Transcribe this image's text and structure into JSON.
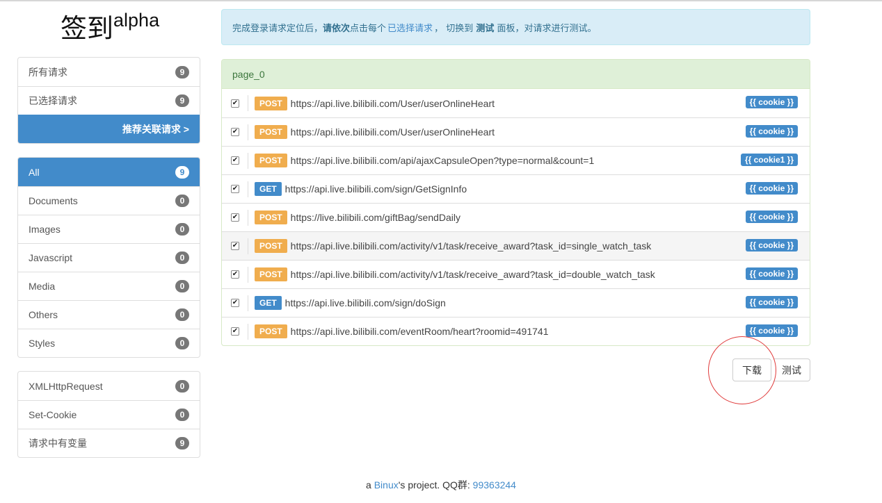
{
  "brand": {
    "title": "签到",
    "sup": "alpha"
  },
  "sidebar": {
    "group1": [
      {
        "label": "所有请求",
        "count": "9"
      },
      {
        "label": "已选择请求",
        "count": "9"
      }
    ],
    "recommend_label": "推荐关联请求 >",
    "types": [
      {
        "label": "All",
        "count": "9"
      },
      {
        "label": "Documents",
        "count": "0"
      },
      {
        "label": "Images",
        "count": "0"
      },
      {
        "label": "Javascript",
        "count": "0"
      },
      {
        "label": "Media",
        "count": "0"
      },
      {
        "label": "Others",
        "count": "0"
      },
      {
        "label": "Styles",
        "count": "0"
      }
    ],
    "filters": [
      {
        "label": "XMLHttpRequest",
        "count": "0"
      },
      {
        "label": "Set-Cookie",
        "count": "0"
      },
      {
        "label": "请求中有变量",
        "count": "9"
      }
    ]
  },
  "alert": {
    "part1": "完成登录请求定位后，",
    "bold1": "请依次",
    "part2": "点击每个",
    "link": "已选择请求",
    "part3": "， 切换到",
    "bold2": "测试",
    "part4": "面板，对请求进行测试。"
  },
  "panel": {
    "heading": "page_0",
    "requests": [
      {
        "method": "POST",
        "url": "https://api.live.bilibili.com/User/userOnlineHeart",
        "var": "{{ cookie }}"
      },
      {
        "method": "POST",
        "url": "https://api.live.bilibili.com/User/userOnlineHeart",
        "var": "{{ cookie }}"
      },
      {
        "method": "POST",
        "url": "https://api.live.bilibili.com/api/ajaxCapsuleOpen?type=normal&count=1",
        "var": "{{ cookie1 }}"
      },
      {
        "method": "GET",
        "url": "https://api.live.bilibili.com/sign/GetSignInfo",
        "var": "{{ cookie }}"
      },
      {
        "method": "POST",
        "url": "https://live.bilibili.com/giftBag/sendDaily",
        "var": "{{ cookie }}"
      },
      {
        "method": "POST",
        "url": "https://api.live.bilibili.com/activity/v1/task/receive_award?task_id=single_watch_task",
        "var": "{{ cookie }}"
      },
      {
        "method": "POST",
        "url": "https://api.live.bilibili.com/activity/v1/task/receive_award?task_id=double_watch_task",
        "var": "{{ cookie }}"
      },
      {
        "method": "GET",
        "url": "https://api.live.bilibili.com/sign/doSign",
        "var": "{{ cookie }}"
      },
      {
        "method": "POST",
        "url": "https://api.live.bilibili.com/eventRoom/heart?roomid=491741",
        "var": "{{ cookie }}"
      }
    ]
  },
  "buttons": {
    "download": "下载",
    "test": "测试"
  },
  "footer": {
    "prefix": "a ",
    "author": "Binux",
    "middle": "'s project. QQ群: ",
    "qq": "99363244"
  }
}
